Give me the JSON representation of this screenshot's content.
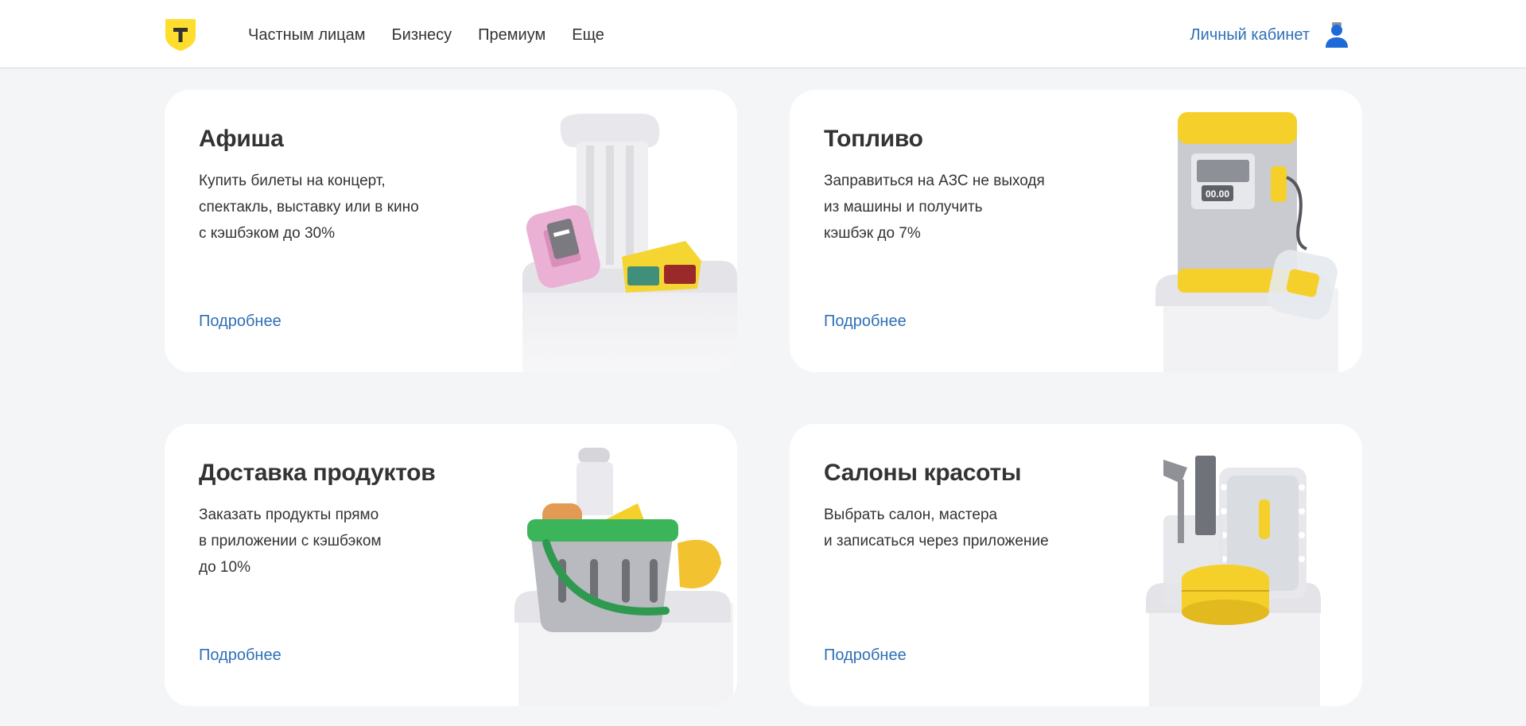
{
  "header": {
    "nav": [
      "Частным лицам",
      "Бизнесу",
      "Премиум",
      "Еще"
    ],
    "account_label": "Личный кабинет",
    "logo_icon": "t-bank-shield-logo",
    "avatar_icon": "user-avatar-icon",
    "accent_color": "#2f6fb6",
    "logo_color": "#ffdd2d"
  },
  "cards": [
    {
      "title": "Афиша",
      "desc": "Купить билеты на концерт,\nспектакль, выставку или в кино\nс кэшбэком до 30%",
      "link": "Подробнее",
      "art": "theater-column-tickets-3d-glasses-illustration"
    },
    {
      "title": "Топливо",
      "desc": "Заправиться на АЗС не выходя\nиз машины и получить\nкэшбэк до 7%",
      "link": "Подробнее",
      "art": "fuel-pump-illustration",
      "pump_display": "00.00"
    },
    {
      "title": "Доставка продуктов",
      "desc": "Заказать продукты прямо\nв приложении с кэшбэком\nдо 10%",
      "link": "Подробнее",
      "art": "grocery-basket-illustration"
    },
    {
      "title": "Салоны красоты",
      "desc": "Выбрать салон, мастера\nи записаться через приложение",
      "link": "Подробнее",
      "art": "beauty-tools-mirror-illustration"
    }
  ]
}
